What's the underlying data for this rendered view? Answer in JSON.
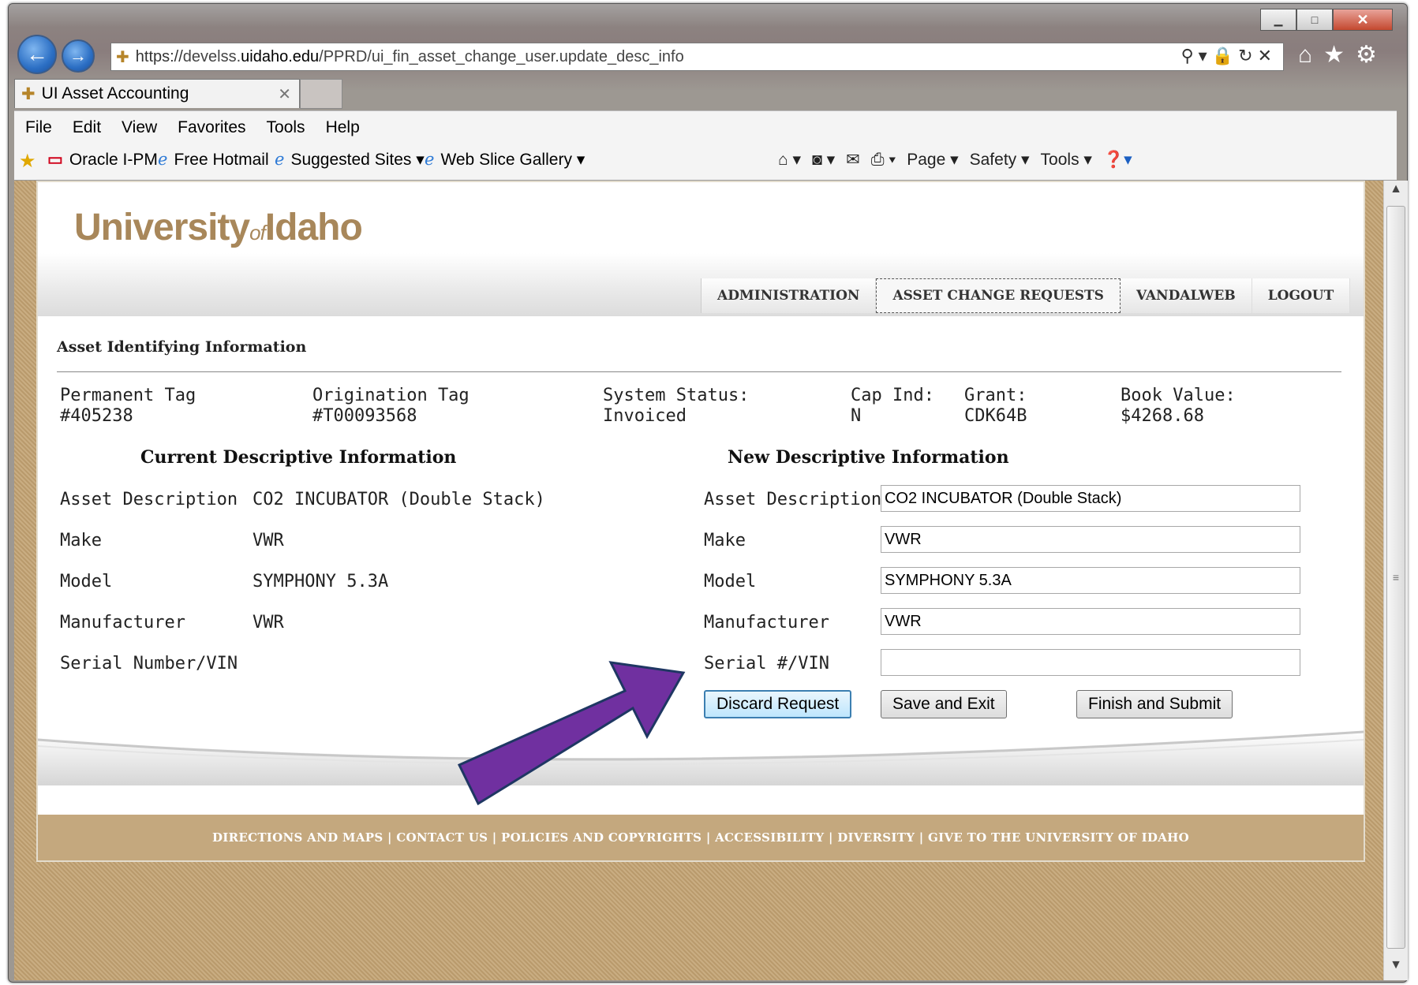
{
  "browser": {
    "url_scheme": "https://",
    "url_host_pre": "develss.",
    "url_host_dom": "uidaho.edu",
    "url_path": "/PPRD/ui_fin_asset_change_user.update_desc_info",
    "tab_title": "UI Asset Accounting",
    "menu": [
      "File",
      "Edit",
      "View",
      "Favorites",
      "Tools",
      "Help"
    ],
    "favorites": [
      "Oracle I-PM",
      "Free Hotmail",
      "Suggested Sites ▾",
      "Web Slice Gallery ▾"
    ],
    "commands": [
      "Page ▾",
      "Safety ▾",
      "Tools ▾"
    ]
  },
  "site": {
    "logo_main_1": "University",
    "logo_of": "of",
    "logo_main_2": "Idaho",
    "nav": [
      "ADMINISTRATION",
      "ASSET CHANGE REQUESTS",
      "VANDALWEB",
      "LOGOUT"
    ],
    "active_nav": "ASSET CHANGE REQUESTS"
  },
  "asset": {
    "section_title": "Asset Identifying Information",
    "permanent_tag_label": "Permanent Tag",
    "permanent_tag_value": "#405238",
    "origination_tag_label": "Origination Tag",
    "origination_tag_value": "#T00093568",
    "system_status_label": "System Status:",
    "system_status_value": "Invoiced",
    "cap_ind_label": "Cap Ind:",
    "cap_ind_value": "N",
    "grant_label": "Grant:",
    "grant_value": "CDK64B",
    "book_value_label": "Book Value:",
    "book_value_value": "$4268.68"
  },
  "current": {
    "heading": "Current Descriptive Information",
    "rows": [
      {
        "label": "Asset Description",
        "value": "CO2 INCUBATOR (Double Stack)"
      },
      {
        "label": "Make",
        "value": "VWR"
      },
      {
        "label": "Model",
        "value": "SYMPHONY 5.3A"
      },
      {
        "label": "Manufacturer",
        "value": "VWR"
      },
      {
        "label": "Serial Number/VIN",
        "value": ""
      }
    ]
  },
  "new": {
    "heading": "New Descriptive Information",
    "rows": [
      {
        "label": "Asset Description",
        "value": "CO2 INCUBATOR (Double Stack)"
      },
      {
        "label": "Make",
        "value": "VWR"
      },
      {
        "label": "Model",
        "value": "SYMPHONY 5.3A"
      },
      {
        "label": "Manufacturer",
        "value": "VWR"
      },
      {
        "label": "Serial #/VIN",
        "value": ""
      }
    ]
  },
  "buttons": {
    "discard": "Discard Request",
    "save": "Save and Exit",
    "finish": "Finish and Submit"
  },
  "footer": "DIRECTIONS AND MAPS | CONTACT US | POLICIES AND COPYRIGHTS | ACCESSIBILITY | DIVERSITY | GIVE TO THE UNIVERSITY OF IDAHO",
  "colors": {
    "annotation_arrow": "#7030a0",
    "brand_gold": "#a8875a",
    "footer_bg": "#c4a87e"
  },
  "icons": [
    "back-icon",
    "forward-icon",
    "search-icon",
    "lock-icon",
    "refresh-icon",
    "stop-icon",
    "home-icon",
    "favorites-star-icon",
    "gear-icon",
    "home-cmd-icon",
    "feeds-icon",
    "mail-icon",
    "print-icon",
    "help-icon"
  ]
}
